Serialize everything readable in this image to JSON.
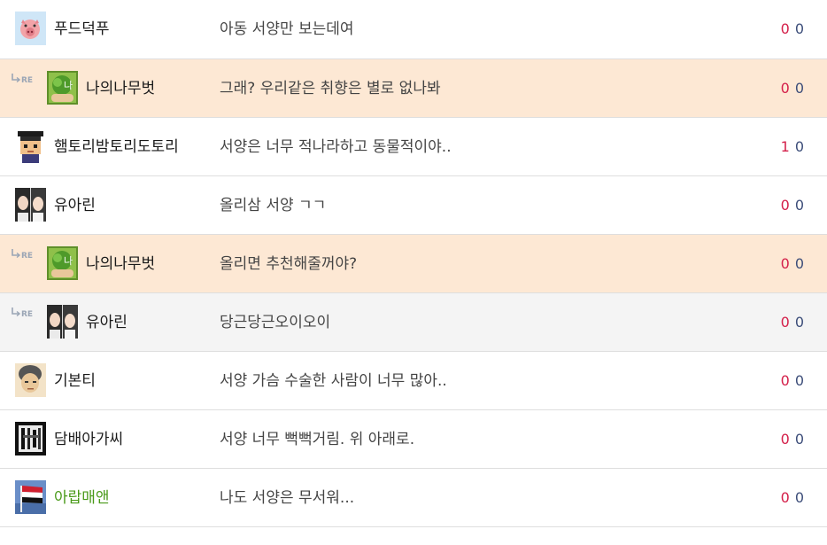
{
  "colors": {
    "upvote": "#d4204a",
    "downvote": "#3d4e7a",
    "highlight_orange": "#fde8d4",
    "highlight_gray": "#f4f4f4",
    "nick_green": "#4a9a1a"
  },
  "reply_icon": "reply-re-icon",
  "comments": [
    {
      "nick": "푸드덕푸",
      "text": "아동 서양만 보는데여",
      "up": "0",
      "down": "0",
      "reply": false,
      "highlight": "",
      "avatar": "pig-avatar",
      "nick_color": ""
    },
    {
      "nick": "나의나무벗",
      "text": "그래? 우리같은 취향은 별로 없나봐",
      "up": "0",
      "down": "0",
      "reply": true,
      "highlight": "orange",
      "avatar": "tree-avatar",
      "nick_color": ""
    },
    {
      "nick": "햄토리밤토리도토리",
      "text": "서양은 너무 적나라하고 동물적이야..",
      "up": "1",
      "down": "0",
      "reply": false,
      "highlight": "",
      "avatar": "pixel-graduate-avatar",
      "nick_color": ""
    },
    {
      "nick": "유아린",
      "text": "올리삼 서양 ㄱㄱ",
      "up": "0",
      "down": "0",
      "reply": false,
      "highlight": "",
      "avatar": "two-girls-avatar",
      "nick_color": ""
    },
    {
      "nick": "나의나무벗",
      "text": "올리면 추천해줄꺼야?",
      "up": "0",
      "down": "0",
      "reply": true,
      "highlight": "orange",
      "avatar": "tree-avatar",
      "nick_color": ""
    },
    {
      "nick": "유아린",
      "text": "당근당근오이오이",
      "up": "0",
      "down": "0",
      "reply": true,
      "highlight": "gray",
      "avatar": "two-girls-avatar",
      "nick_color": ""
    },
    {
      "nick": "기본티",
      "text": "서양 가슴 수술한 사람이 너무 많아..",
      "up": "0",
      "down": "0",
      "reply": false,
      "highlight": "",
      "avatar": "default-face-avatar",
      "nick_color": ""
    },
    {
      "nick": "담배아가씨",
      "text": "서양 너무 뻑뻑거림. 위 아래로.",
      "up": "0",
      "down": "0",
      "reply": false,
      "highlight": "",
      "avatar": "bw-photo-avatar",
      "nick_color": ""
    },
    {
      "nick": "아랍매앤",
      "text": "나도 서양은 무서워...",
      "up": "0",
      "down": "0",
      "reply": false,
      "highlight": "",
      "avatar": "flag-avatar",
      "nick_color": "green"
    }
  ]
}
